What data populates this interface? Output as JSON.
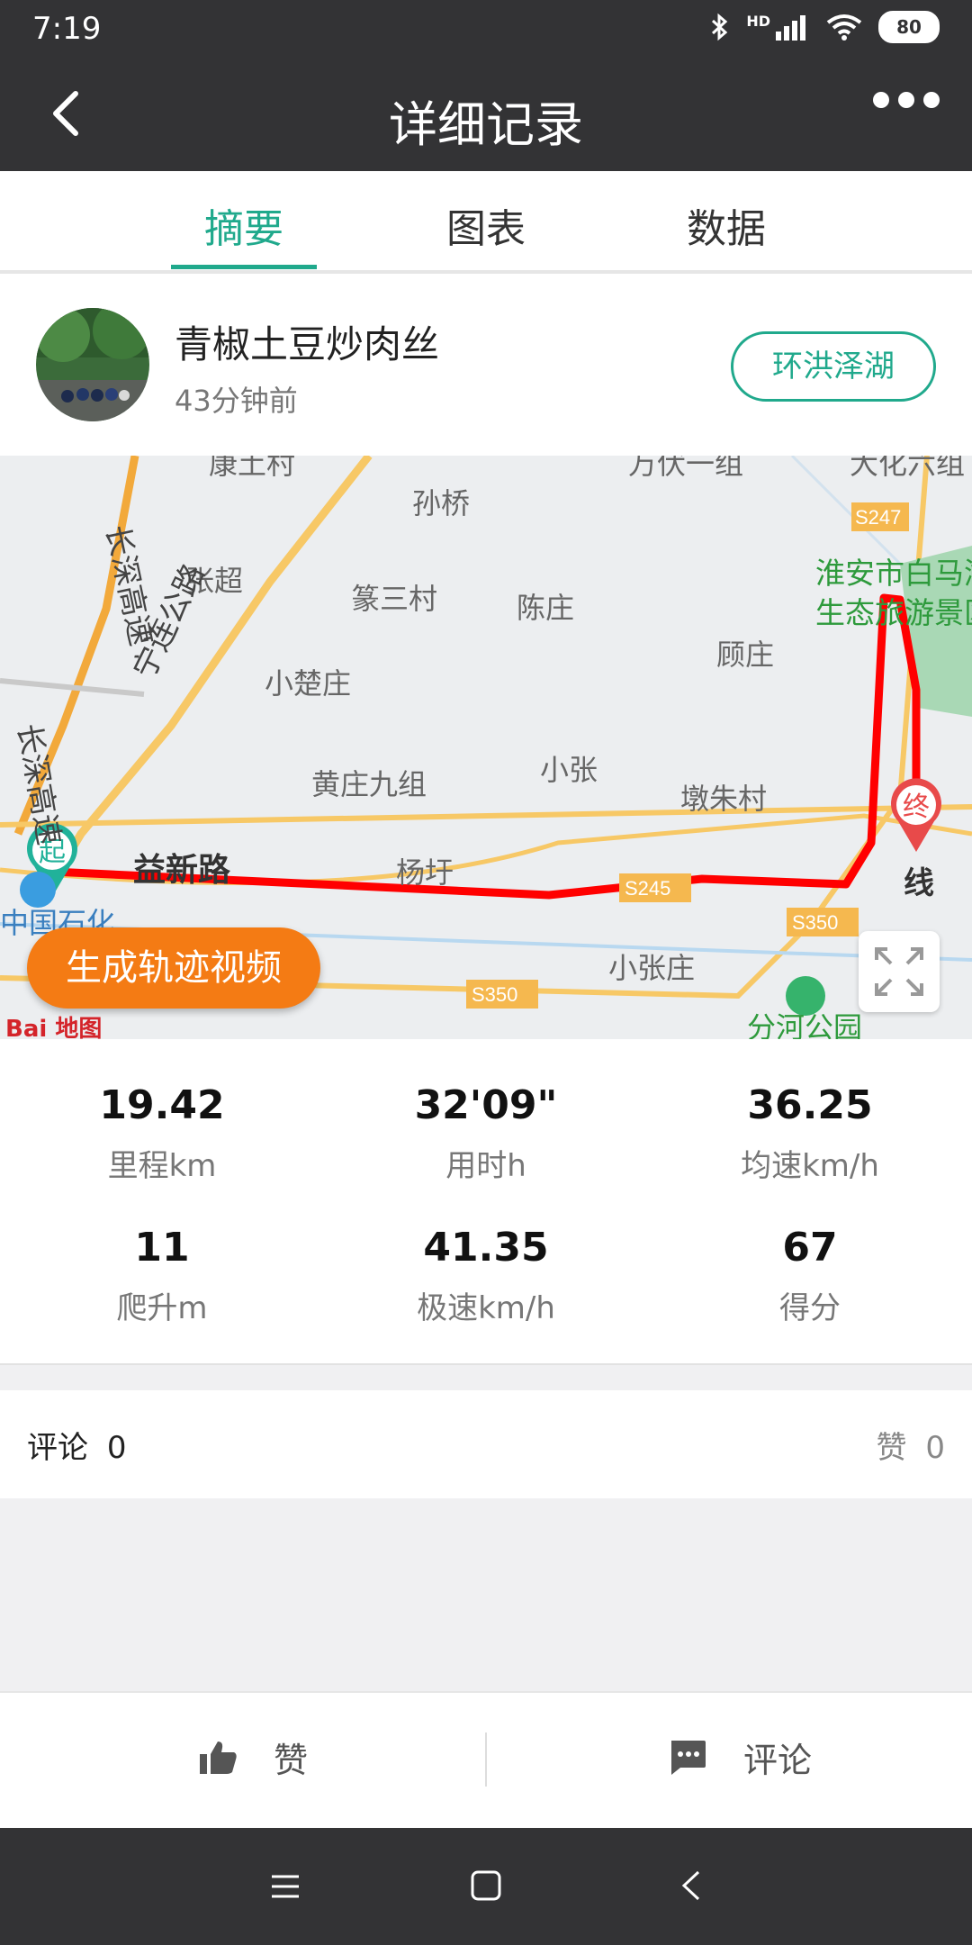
{
  "status_bar": {
    "time": "7:19",
    "battery": "80",
    "network": "HD"
  },
  "header": {
    "title": "详细记录"
  },
  "tabs": [
    {
      "label": "摘要",
      "active": true
    },
    {
      "label": "图表",
      "active": false
    },
    {
      "label": "数据",
      "active": false
    }
  ],
  "user": {
    "name": "青椒土豆炒肉丝",
    "time_ago": "43分钟前",
    "route_badge": "环洪泽湖"
  },
  "map": {
    "labels": [
      "康土村",
      "万伏一组",
      "大化六组",
      "孙桥",
      "S247",
      "长深高速",
      "张超",
      "篆三村",
      "陈庄",
      "淮安市白马湖",
      "生态旅游景区",
      "小楚庄",
      "宁连公路",
      "顾庄",
      "黄庄九组",
      "小张",
      "墩朱村",
      "长深高速",
      "益新路",
      "杨圩",
      "S245",
      "中国石化",
      "S350",
      "小张庄",
      "S350",
      "分河公园",
      "线"
    ],
    "start_marker": "起",
    "end_marker": "终",
    "generate_video_label": "生成轨迹视频",
    "logo": "Bai 地图"
  },
  "stats": [
    {
      "value": "19.42",
      "label": "里程km"
    },
    {
      "value": "32'09\"",
      "label": "用时h"
    },
    {
      "value": "36.25",
      "label": "均速km/h"
    },
    {
      "value": "11",
      "label": "爬升m"
    },
    {
      "value": "41.35",
      "label": "极速km/h"
    },
    {
      "value": "67",
      "label": "得分"
    }
  ],
  "comments": {
    "comment_label": "评论",
    "comment_count": "0",
    "like_label": "赞",
    "like_count": "0"
  },
  "actions": {
    "like_label": "赞",
    "comment_label": "评论"
  },
  "colors": {
    "accent": "#20a98c",
    "route": "#ff0000",
    "generate_button": "#f47b14",
    "header_bg": "#333335"
  }
}
